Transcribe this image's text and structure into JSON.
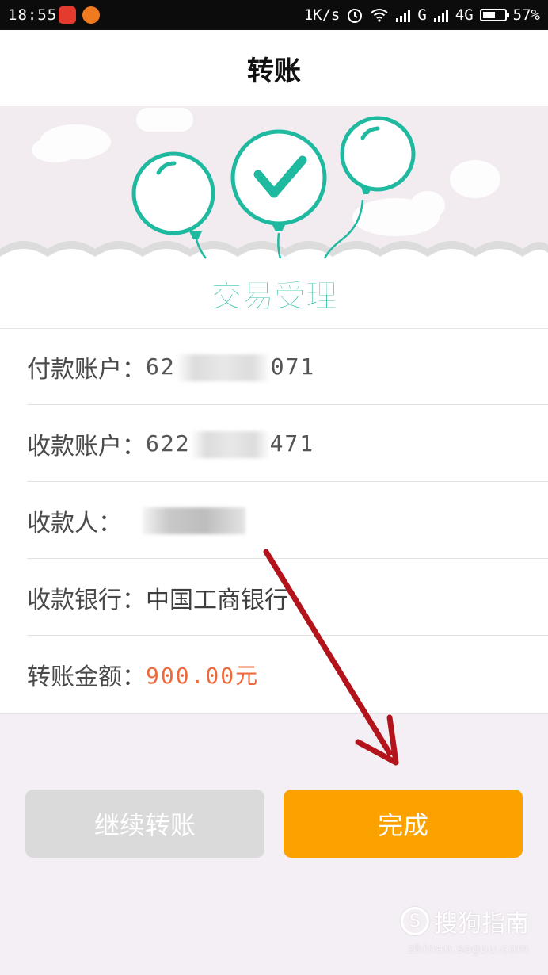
{
  "status_bar": {
    "time": "18:55",
    "net_speed": "1K/s",
    "network_label": "G",
    "network_label_2": "4G",
    "battery_percent": "57%",
    "battery_level": 0.57
  },
  "header": {
    "title": "转账"
  },
  "banner": {
    "caption": "交易受理",
    "accent_color": "#1fb9a0"
  },
  "details": {
    "payer": {
      "label": "付款账户：",
      "value_start": "62",
      "value_end": "071"
    },
    "payee_account": {
      "label": "收款账户：",
      "value_start": "622",
      "value_end": "471"
    },
    "payee_name": {
      "label": "收款人："
    },
    "bank": {
      "label": "收款银行：",
      "value": "中国工商银行"
    },
    "amount": {
      "label": "转账金额：",
      "value": "900.00元",
      "color": "#ee6a3c"
    }
  },
  "buttons": {
    "continue_label": "继续转账",
    "done_label": "完成",
    "done_color": "#fba200"
  },
  "watermark": {
    "logo_glyph": "S",
    "text": "搜狗指南",
    "sub": "zhinan.sogou.com"
  }
}
